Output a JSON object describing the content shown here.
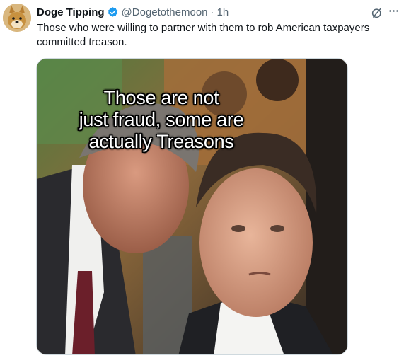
{
  "author": {
    "display_name": "Doge Tipping",
    "handle": "@Dogetothemoon",
    "separator": "·",
    "time": "1h",
    "avatar_icon": "shiba-dog-avatar",
    "verified_color": "#1d9bf0"
  },
  "tweet": {
    "text": "Those who were willing to partner with them to rob American taxpayers committed treason."
  },
  "media": {
    "caption_lines": [
      "Those are not",
      "just fraud, some are",
      "actually Treasons"
    ]
  },
  "actions": {
    "grok_icon": "grok-icon",
    "more_icon": "more-dots-icon"
  }
}
